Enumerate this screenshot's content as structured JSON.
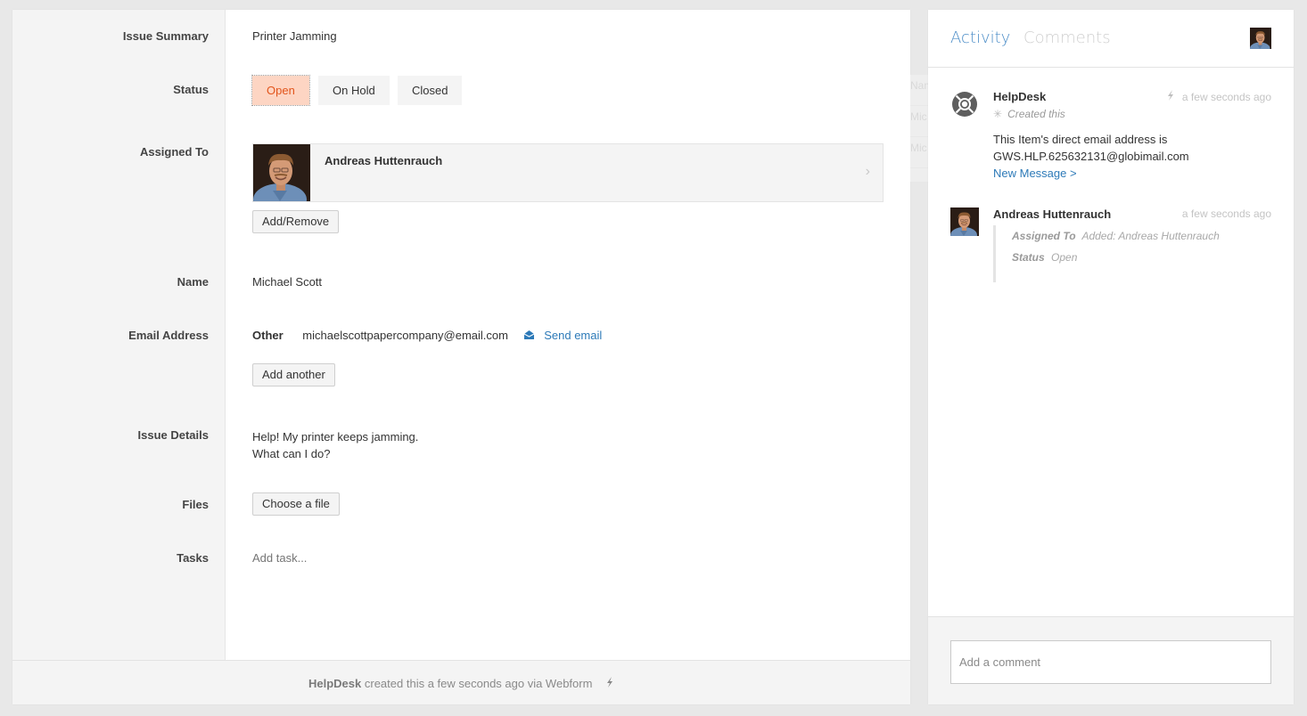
{
  "form": {
    "fields": {
      "issue_summary": {
        "label": "Issue Summary",
        "value": "Printer Jamming"
      },
      "status": {
        "label": "Status",
        "options": [
          "Open",
          "On Hold",
          "Closed"
        ],
        "selected": "Open"
      },
      "assigned_to": {
        "label": "Assigned To",
        "assignee_name": "Andreas Huttenrauch",
        "add_remove_label": "Add/Remove"
      },
      "name": {
        "label": "Name",
        "value": "Michael Scott"
      },
      "email": {
        "label": "Email Address",
        "type": "Other",
        "address": "michaelscottpapercompany@email.com",
        "send_label": "Send email",
        "add_another_label": "Add another"
      },
      "issue_details": {
        "label": "Issue Details",
        "lines": [
          "Help! My printer keeps jamming.",
          "What can I do?"
        ]
      },
      "files": {
        "label": "Files",
        "choose_label": "Choose a file"
      },
      "tasks": {
        "label": "Tasks",
        "placeholder": "Add task..."
      }
    },
    "footer": {
      "author": "HelpDesk",
      "text": "created this a few seconds ago via Webform",
      "icon": "lightning-icon"
    }
  },
  "ghost": [
    "Nam",
    "Mic",
    "Mic"
  ],
  "colors": {
    "accent": "#4a8cc7",
    "link": "#2d7ab8",
    "status_open_bg": "#fdd5c3",
    "status_open_text": "#e2551c"
  },
  "panel": {
    "tabs": [
      {
        "label": "Activity",
        "active": true
      },
      {
        "label": "Comments",
        "active": false
      }
    ],
    "activity": [
      {
        "author": "HelpDesk",
        "avatar_icon": "lifebuoy-icon",
        "time": "a few seconds ago",
        "time_icon": "lightning-icon",
        "action": "Created this",
        "action_icon": "sparkle-icon",
        "message_lines": [
          "This Item's direct email address is",
          "GWS.HLP.625632131@globimail.com"
        ],
        "link": "New Message >"
      },
      {
        "author": "Andreas Huttenrauch",
        "time": "a few seconds ago",
        "changes": [
          {
            "field": "Assigned To",
            "value": "Added: Andreas Huttenrauch"
          },
          {
            "field": "Status",
            "value": "Open"
          }
        ]
      }
    ],
    "comment_placeholder": "Add a comment"
  }
}
